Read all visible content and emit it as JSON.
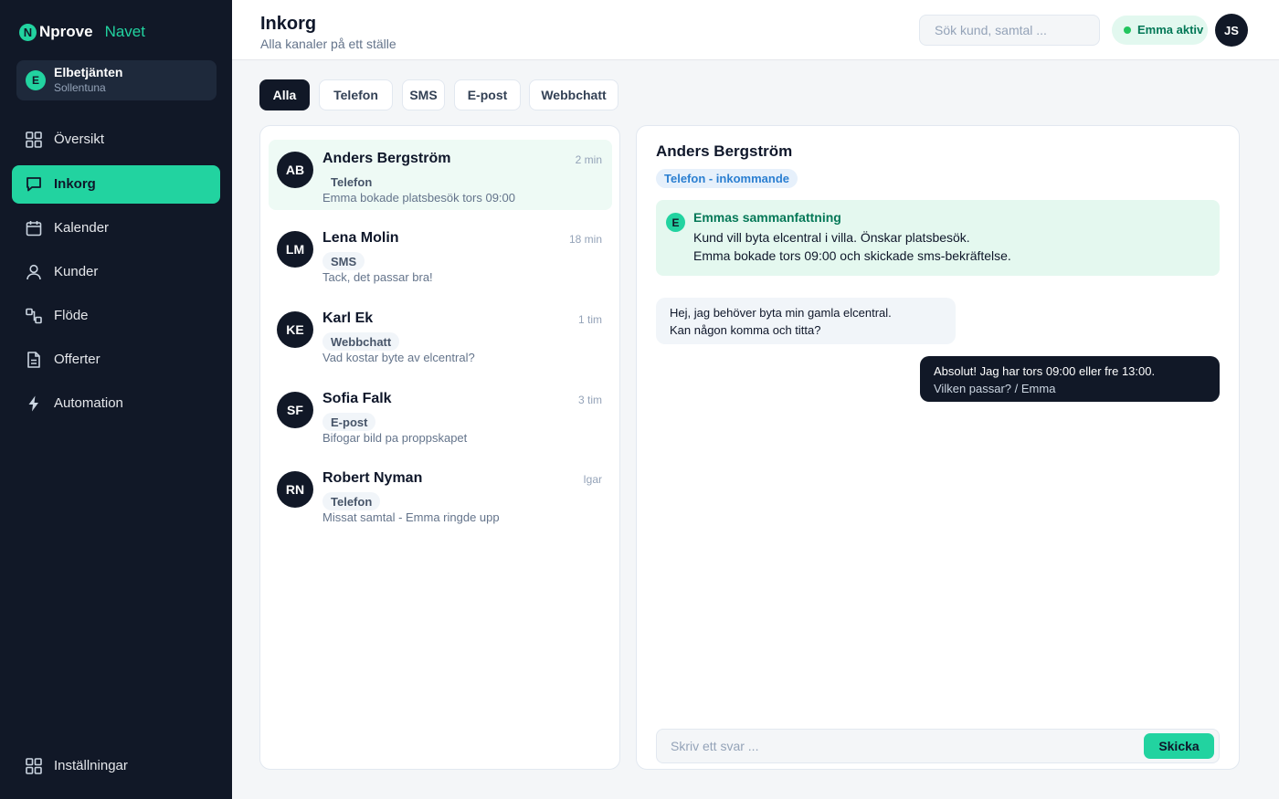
{
  "brand": {
    "logo_letter": "N",
    "name": "Nprove",
    "sub": "Navet"
  },
  "org": {
    "avatar": "E",
    "name": "Elbetjänten",
    "location": "Sollentuna"
  },
  "nav": {
    "items": [
      {
        "label": "Översikt",
        "icon": "grid-icon"
      },
      {
        "label": "Inkorg",
        "icon": "chat-icon",
        "active": true
      },
      {
        "label": "Kalender",
        "icon": "calendar-icon"
      },
      {
        "label": "Kunder",
        "icon": "user-icon"
      },
      {
        "label": "Flöde",
        "icon": "flow-icon"
      },
      {
        "label": "Offerter",
        "icon": "document-icon"
      },
      {
        "label": "Automation",
        "icon": "bolt-icon"
      }
    ],
    "settings": {
      "label": "Inställningar",
      "icon": "grid-icon"
    }
  },
  "header": {
    "title": "Inkorg",
    "subtitle": "Alla kanaler på ett ställe",
    "search_placeholder": "Sök kund, samtal ...",
    "status": "Emma aktiv",
    "user_initials": "JS"
  },
  "tabs": [
    "Alla",
    "Telefon",
    "SMS",
    "E-post",
    "Webbchatt"
  ],
  "active_tab": "Alla",
  "conversations": [
    {
      "initials": "AB",
      "name": "Anders Bergström",
      "time": "2 min",
      "channel": "Telefon",
      "preview": "Emma bokade platsbesök tors 09:00",
      "selected": true
    },
    {
      "initials": "LM",
      "name": "Lena Molin",
      "time": "18 min",
      "channel": "SMS",
      "preview": "Tack, det passar bra!"
    },
    {
      "initials": "KE",
      "name": "Karl Ek",
      "time": "1 tim",
      "channel": "Webbchatt",
      "preview": "Vad kostar byte av elcentral?"
    },
    {
      "initials": "SF",
      "name": "Sofia Falk",
      "time": "3 tim",
      "channel": "E-post",
      "preview": "Bifogar bild pa proppskapet"
    },
    {
      "initials": "RN",
      "name": "Robert Nyman",
      "time": "Igar",
      "channel": "Telefon",
      "preview": "Missat samtal - Emma ringde upp"
    }
  ],
  "detail": {
    "name": "Anders Bergström",
    "channel_chip": "Telefon - inkommande",
    "summary": {
      "avatar": "E",
      "title": "Emmas sammanfattning",
      "lines": [
        "Kund vill byta elcentral i villa. Önskar platsbesök.",
        "Emma bokade tors 09:00 och skickade sms-bekräftelse."
      ]
    },
    "messages": [
      {
        "direction": "in",
        "lines": [
          "Hej, jag behöver byta min gamla elcentral.",
          "Kan någon komma och titta?"
        ]
      },
      {
        "direction": "out",
        "lines": [
          "Absolut! Jag har tors 09:00 eller fre 13:00.",
          "Vilken passar? / Emma"
        ]
      }
    ],
    "reply_placeholder": "Skriv ett svar ...",
    "send_label": "Skicka"
  },
  "colors": {
    "sidebar_bg": "#111827",
    "accent": "#22d3a0",
    "summary_bg": "#e4f8ef",
    "chip_blue": "#2b7fd1"
  }
}
